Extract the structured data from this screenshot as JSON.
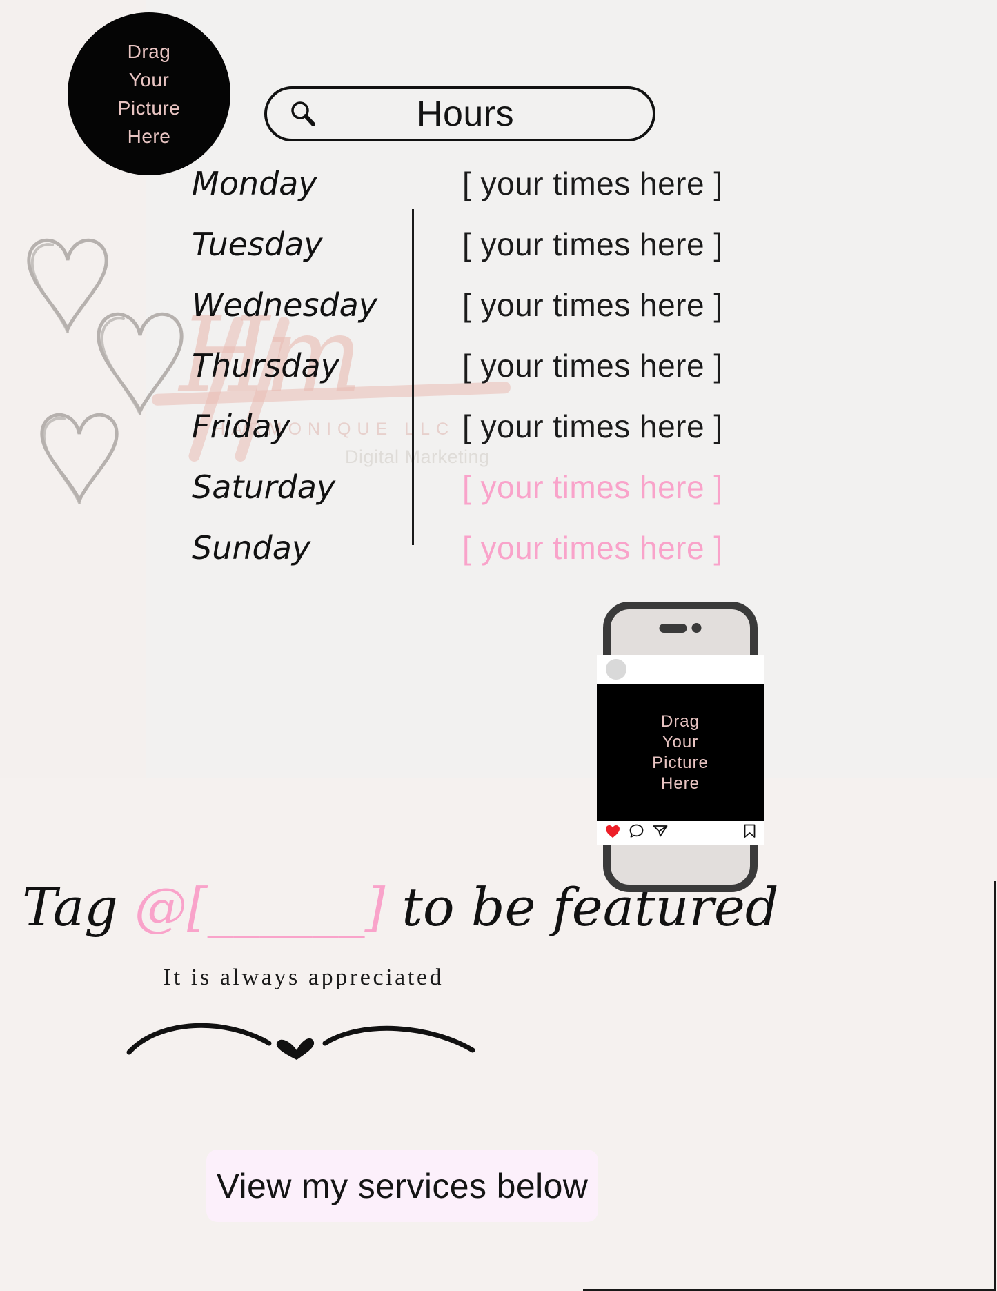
{
  "theme": {
    "background": "#f4f0ee",
    "panel_upper": "#f2f1f0",
    "accent_pink": "#f9a3ca",
    "avatar_text": "#e8c4c2",
    "cta_background": "#fcf0fb",
    "heart_outline": "#b6b1ae",
    "watermark": "#e9bcb4",
    "ink": "#111111"
  },
  "avatar": {
    "icon": "drag-picture-placeholder",
    "lines": [
      "Drag",
      "Your",
      "Picture",
      "Here"
    ]
  },
  "search": {
    "icon": "search-icon",
    "title": "Hours"
  },
  "hours": {
    "rows": [
      {
        "day": "Monday",
        "time": "[ your times here ]",
        "highlight": false
      },
      {
        "day": "Tuesday",
        "time": "[ your times here ]",
        "highlight": false
      },
      {
        "day": "Wednesday",
        "time": "[ your times here ]",
        "highlight": false
      },
      {
        "day": "Thursday",
        "time": "[ your times here ]",
        "highlight": false
      },
      {
        "day": "Friday",
        "time": "[ your times here ]",
        "highlight": false
      },
      {
        "day": "Saturday",
        "time": "[ your times here ]",
        "highlight": true
      },
      {
        "day": "Sunday",
        "time": "[ your times here ]",
        "highlight": true
      }
    ]
  },
  "watermark": {
    "script": "Hm",
    "name": "HARMONIQUE LLC",
    "subtitle": "Digital Marketing"
  },
  "phone": {
    "post": {
      "lines": [
        "Drag",
        "Your",
        "Picture",
        "Here"
      ]
    },
    "actions": [
      "heart-icon",
      "comment-icon",
      "share-icon",
      "bookmark-icon"
    ]
  },
  "tag": {
    "prefix": "Tag ",
    "handle": "@[______]",
    "suffix": " to be featured",
    "note": "It is always appreciated"
  },
  "divider": {
    "icon": "heart-icon"
  },
  "cta": {
    "label": "View my services below"
  }
}
